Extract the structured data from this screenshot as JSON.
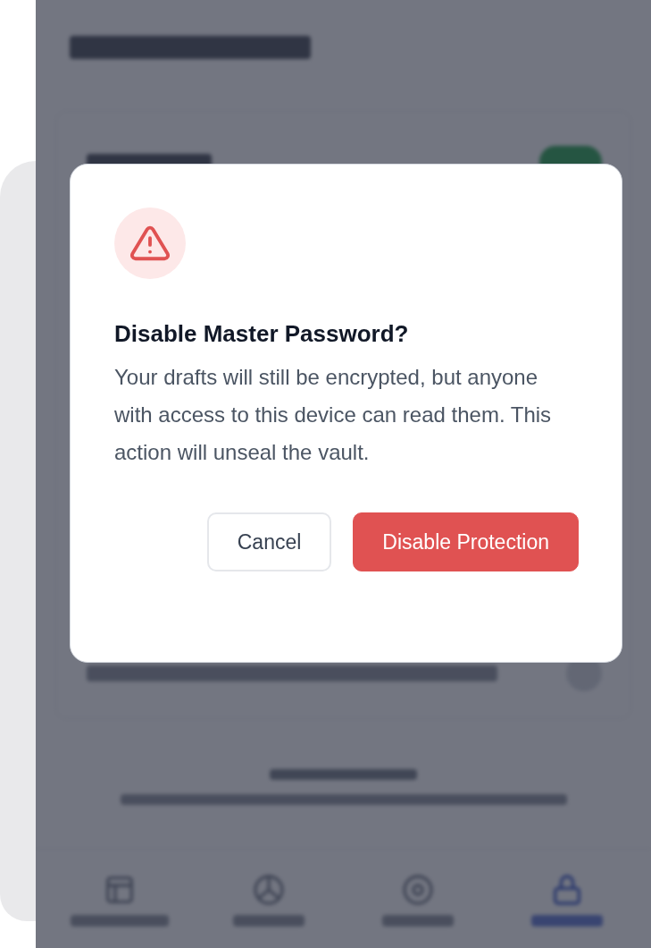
{
  "settings": [
    {
      "on": true
    },
    {
      "on": false
    }
  ],
  "nav": [
    {
      "kind": "site",
      "selected": false
    },
    {
      "kind": "vault",
      "selected": false
    },
    {
      "kind": "settings",
      "selected": false
    },
    {
      "kind": "lock",
      "selected": true
    }
  ],
  "dialog": {
    "title": "Disable Master Password?",
    "message": "Your drafts will still be encrypted, but anyone with access to this device can read them. This action will unseal the vault.",
    "buttons": [
      {
        "label": "Cancel",
        "kind": "secondary"
      },
      {
        "label": "Disable Protection",
        "kind": "danger"
      }
    ]
  }
}
